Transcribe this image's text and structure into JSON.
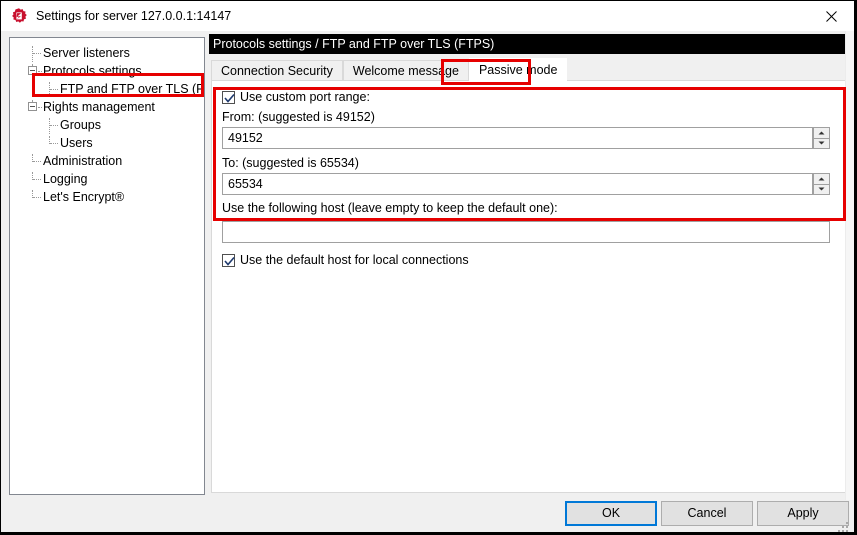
{
  "window": {
    "title": "Settings for server 127.0.0.1:14147",
    "icon": "filezilla-server-icon",
    "close_label": "✕"
  },
  "sidebar": {
    "items": [
      {
        "label": "Server listeners",
        "level": 1,
        "expander": false
      },
      {
        "label": "Protocols settings",
        "level": 0,
        "expander": true
      },
      {
        "label": "FTP and FTP over TLS (FTPS)",
        "level": 2,
        "expander": false,
        "selected": true
      },
      {
        "label": "Rights management",
        "level": 0,
        "expander": true
      },
      {
        "label": "Groups",
        "level": 2,
        "expander": false
      },
      {
        "label": "Users",
        "level": 2,
        "expander": false
      },
      {
        "label": "Administration",
        "level": 1,
        "expander": false
      },
      {
        "label": "Logging",
        "level": 1,
        "expander": false
      },
      {
        "label": "Let's Encrypt®",
        "level": 1,
        "expander": false
      }
    ]
  },
  "main": {
    "breadcrumb": "Protocols settings / FTP and FTP over TLS (FTPS)",
    "tabs": [
      {
        "label": "Connection Security",
        "active": false
      },
      {
        "label": "Welcome message",
        "active": false
      },
      {
        "label": "Passive mode",
        "active": true
      }
    ],
    "passive_mode": {
      "use_custom_port_range": {
        "label": "Use custom port range:",
        "checked": true
      },
      "from": {
        "label": "From: (suggested is 49152)",
        "value": "49152"
      },
      "to": {
        "label": "To: (suggested is 65534)",
        "value": "65534"
      },
      "host": {
        "label": "Use the following host (leave empty to keep the default one):",
        "value": "",
        "placeholder": ""
      },
      "use_default_host_local": {
        "label": "Use the default host for local connections",
        "checked": true
      }
    }
  },
  "footer": {
    "ok_label": "OK",
    "cancel_label": "Cancel",
    "apply_label": "Apply"
  },
  "annotations": {
    "accent_color": "#e60000",
    "focus_color": "#0078d7"
  }
}
